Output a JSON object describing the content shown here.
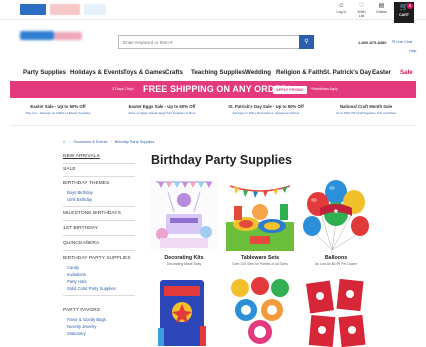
{
  "topbar": {
    "utils": [
      {
        "icon": "person-icon",
        "glyph": "☺",
        "label": "Log In"
      },
      {
        "icon": "heart-icon",
        "glyph": "♡",
        "label": "Wish List"
      },
      {
        "icon": "orders-icon",
        "glyph": "▤",
        "label": "Orders"
      }
    ],
    "cart_label": "CART",
    "cart_count": "0"
  },
  "search": {
    "placeholder": "Enter Keyword or Item #"
  },
  "header": {
    "phone": "1-800-875-8480",
    "live_chat": "Live Chat",
    "help": "Help"
  },
  "nav": [
    "Party Supplies",
    "Holidays & Events",
    "Toys & Games",
    "Crafts",
    "Teaching Supplies",
    "Wedding",
    "Religion & Faith",
    "St. Patrick's Day",
    "Easter",
    "Sale"
  ],
  "banner": {
    "left": "3 Days Only!",
    "main": "FREE SHIPPING ON ANY ORDER*",
    "button": "APPLY PROMO",
    "fine": "*Restrictions Apply"
  },
  "promos": [
    {
      "title": "Easter Sale - Up to 60% Off",
      "sub": "Hop to it - Savings on 1000s of Easter Supplies"
    },
    {
      "title": "Easter Eggs Sale - Up to 60% Off",
      "sub": "Save on Eggs, Easter Egg Hunt Supplies & More"
    },
    {
      "title": "St. Patrick's Day Sale - Up to 50% Off",
      "sub": "Savings on Party Decorations, Apparel and More"
    },
    {
      "title": "National Craft Month Sale",
      "sub": "Up to 50% Off Craft Supplies, Kits and More"
    }
  ],
  "breadcrumb": [
    "Occasions & Events",
    "Birthday Party Supplies"
  ],
  "sidebar": {
    "sections": [
      {
        "head": "NEW ARRIVALS",
        "links": []
      },
      {
        "head": "SALE",
        "links": []
      },
      {
        "head": "BIRTHDAY THEMES",
        "links": [
          "Boys Birthday",
          "Girls Birthday"
        ]
      },
      {
        "head": "MILESTONE BIRTHDAYS",
        "links": []
      },
      {
        "head": "1ST BIRTHDAY",
        "links": []
      },
      {
        "head": "QUINCEAÑERA",
        "links": []
      },
      {
        "head": "BIRTHDAY PARTY SUPPLIES",
        "links": [
          "Candy",
          "Invitations",
          "Party Hats",
          "Solid Color Party Supplies"
        ]
      },
      {
        "head": "PARTY FAVORS",
        "links": [
          "Favor & Goody Bags",
          "Novelty Jewelry",
          "Stationery"
        ]
      }
    ]
  },
  "main": {
    "title": "Birthday Party Supplies",
    "tiles": [
      {
        "name": "Decorating Kits",
        "sub": "Decorating Made Easy"
      },
      {
        "name": "Tableware Sets",
        "sub": "Over 100 Sets for Parties of All Sizes"
      },
      {
        "name": "Balloons",
        "sub": "As Low As $0.99 Per Dozen"
      },
      {
        "name": "",
        "sub": ""
      },
      {
        "name": "",
        "sub": ""
      },
      {
        "name": "",
        "sub": ""
      }
    ]
  },
  "colors": {
    "accent_pink": "#e23a7d",
    "link_blue": "#2c5fab",
    "sale_red": "#d31c5a"
  }
}
